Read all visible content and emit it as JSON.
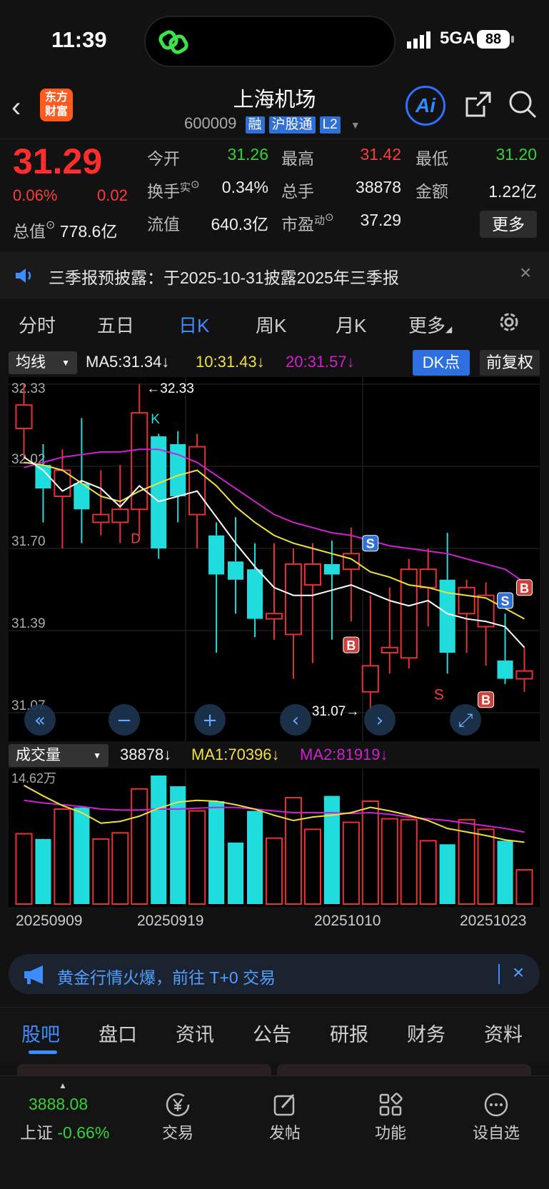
{
  "status": {
    "time": "11:39",
    "network": "5GA",
    "battery": "88"
  },
  "header": {
    "logo": [
      "东方",
      "财富"
    ],
    "title": "上海机场",
    "code": "600009",
    "tags": [
      "融",
      "沪股通",
      "L2"
    ],
    "ai_label": "Ai"
  },
  "quote": {
    "price": "31.29",
    "pct": "0.06%",
    "change": "0.02",
    "mktcap_label": "总值",
    "mktcap": "778.6亿",
    "open_label": "今开",
    "open": "31.26",
    "high_label": "最高",
    "high": "31.42",
    "low_label": "最低",
    "low": "31.20",
    "turnover_label": "换手",
    "turnover_sup": "实",
    "turnover": "0.34%",
    "volume_label": "总手",
    "volume": "38878",
    "amount_label": "金额",
    "amount": "1.22亿",
    "float_label": "流值",
    "float": "640.3亿",
    "pe_label": "市盈",
    "pe_sup": "动",
    "pe": "37.29",
    "more": "更多"
  },
  "notice": {
    "text": "三季报预披露：于2025-10-31披露2025年三季报",
    "close": "×"
  },
  "tabs": [
    {
      "label": "分时"
    },
    {
      "label": "五日"
    },
    {
      "label": "日K"
    },
    {
      "label": "周K"
    },
    {
      "label": "月K"
    },
    {
      "label": "更多"
    }
  ],
  "indicators": {
    "main_dropdown": "均线",
    "ma5": "MA5:31.34↓",
    "ma10": "10:31.43↓",
    "ma20": "20:31.57↓",
    "dk": "DK点",
    "fq": "前复权",
    "vol_dropdown": "成交量",
    "vol": "38878↓",
    "vma1": "MA1:70396↓",
    "vma2": "MA2:81919↓"
  },
  "chart_data": [
    {
      "type": "candlestick",
      "title": "",
      "yticks": [
        "32.33",
        "32.02",
        "31.70",
        "31.39",
        "31.07"
      ],
      "ylim": [
        31.07,
        32.33
      ],
      "annotations": {
        "high": "←32.33",
        "low": "31.07→",
        "k": "K",
        "d": "D",
        "s_text": "S"
      },
      "signals": [
        {
          "label": "S",
          "index": 18
        },
        {
          "label": "B",
          "index": 17
        },
        {
          "label": "S",
          "index": 25
        },
        {
          "label": "B",
          "index": 24
        },
        {
          "label": "B",
          "index": 26
        }
      ],
      "candles": [
        {
          "o": 32.16,
          "c": 32.25,
          "h": 32.33,
          "l": 32.05
        },
        {
          "o": 32.02,
          "c": 31.93,
          "h": 32.1,
          "l": 31.8
        },
        {
          "o": 31.9,
          "c": 32.0,
          "h": 32.08,
          "l": 31.7
        },
        {
          "o": 31.95,
          "c": 31.85,
          "h": 32.2,
          "l": 31.72
        },
        {
          "o": 31.8,
          "c": 31.83,
          "h": 32.0,
          "l": 31.75
        },
        {
          "o": 31.8,
          "c": 31.85,
          "h": 32.02,
          "l": 31.72
        },
        {
          "o": 31.85,
          "c": 32.22,
          "h": 32.33,
          "l": 31.75
        },
        {
          "o": 32.13,
          "c": 31.7,
          "h": 32.14,
          "l": 31.66
        },
        {
          "o": 32.1,
          "c": 31.9,
          "h": 32.15,
          "l": 31.8
        },
        {
          "o": 31.83,
          "c": 32.09,
          "h": 32.14,
          "l": 31.7
        },
        {
          "o": 31.75,
          "c": 31.6,
          "h": 31.8,
          "l": 31.3
        },
        {
          "o": 31.65,
          "c": 31.58,
          "h": 31.82,
          "l": 31.45
        },
        {
          "o": 31.62,
          "c": 31.43,
          "h": 31.72,
          "l": 31.36
        },
        {
          "o": 31.43,
          "c": 31.45,
          "h": 31.72,
          "l": 31.35
        },
        {
          "o": 31.37,
          "c": 31.64,
          "h": 31.7,
          "l": 31.2
        },
        {
          "o": 31.56,
          "c": 31.64,
          "h": 31.72,
          "l": 31.26
        },
        {
          "o": 31.64,
          "c": 31.6,
          "h": 31.73,
          "l": 31.35
        },
        {
          "o": 31.62,
          "c": 31.68,
          "h": 31.78,
          "l": 31.42
        },
        {
          "o": 31.15,
          "c": 31.25,
          "h": 31.52,
          "l": 31.07
        },
        {
          "o": 31.3,
          "c": 31.32,
          "h": 31.55,
          "l": 31.22
        },
        {
          "o": 31.28,
          "c": 31.62,
          "h": 31.66,
          "l": 31.24
        },
        {
          "o": 31.55,
          "c": 31.62,
          "h": 31.7,
          "l": 31.4
        },
        {
          "o": 31.58,
          "c": 31.3,
          "h": 31.76,
          "l": 31.22
        },
        {
          "o": 31.45,
          "c": 31.55,
          "h": 31.58,
          "l": 31.3
        },
        {
          "o": 31.4,
          "c": 31.52,
          "h": 31.57,
          "l": 31.25
        },
        {
          "o": 31.27,
          "c": 31.2,
          "h": 31.45,
          "l": 31.18
        },
        {
          "o": 31.2,
          "c": 31.23,
          "h": 31.32,
          "l": 31.15
        }
      ],
      "ma5": [
        32.05,
        32.0,
        31.92,
        31.96,
        31.93,
        31.86,
        31.94,
        31.88,
        31.9,
        31.92,
        31.82,
        31.72,
        31.63,
        31.55,
        31.52,
        31.52,
        31.54,
        31.56,
        31.53,
        31.5,
        31.48,
        31.5,
        31.45,
        31.43,
        31.42,
        31.4,
        31.32
      ],
      "ma10": [
        32.03,
        32.02,
        32.0,
        31.95,
        31.9,
        31.88,
        31.92,
        31.95,
        31.98,
        32.0,
        31.94,
        31.86,
        31.8,
        31.75,
        31.72,
        31.7,
        31.68,
        31.66,
        31.61,
        31.59,
        31.56,
        31.55,
        31.53,
        31.52,
        31.51,
        31.47,
        31.43
      ],
      "ma20": [
        32.01,
        32.03,
        32.05,
        32.06,
        32.07,
        32.07,
        32.08,
        32.08,
        32.06,
        32.03,
        31.98,
        31.93,
        31.88,
        31.83,
        31.8,
        31.78,
        31.76,
        31.75,
        31.73,
        31.71,
        31.7,
        31.69,
        31.68,
        31.66,
        31.64,
        31.62,
        31.57
      ]
    },
    {
      "type": "bar",
      "title": "",
      "ymax_label": "14.62万",
      "ylim": [
        0,
        146200
      ],
      "volumes": [
        80000,
        74000,
        108000,
        110000,
        74000,
        81000,
        131000,
        146200,
        134000,
        106000,
        117000,
        70000,
        106000,
        75000,
        121000,
        85000,
        123000,
        93000,
        117000,
        97000,
        96000,
        72000,
        68000,
        96000,
        85000,
        72000,
        38878
      ],
      "vma1": [
        135000,
        123000,
        112000,
        104000,
        92000,
        94000,
        100000,
        109000,
        116000,
        118000,
        117000,
        113000,
        108000,
        101000,
        95000,
        99000,
        101000,
        104000,
        110000,
        106000,
        101000,
        95000,
        86000,
        82000,
        78000,
        73000,
        70396
      ],
      "vma2": [
        118000,
        115000,
        113000,
        111000,
        108000,
        107000,
        107000,
        108000,
        108000,
        109000,
        110000,
        110000,
        108000,
        106000,
        104000,
        104000,
        104000,
        103000,
        104000,
        102000,
        99000,
        97000,
        95000,
        92000,
        89000,
        86000,
        81919
      ],
      "dates": [
        "20250909",
        "20250919",
        "20251010",
        "20251023"
      ]
    }
  ],
  "promo": {
    "text": "黄金行情火爆，前往 T+0 交易",
    "close": "×"
  },
  "bottom_tabs": [
    {
      "label": "股吧"
    },
    {
      "label": "盘口"
    },
    {
      "label": "资讯"
    },
    {
      "label": "公告"
    },
    {
      "label": "研报"
    },
    {
      "label": "财务"
    },
    {
      "label": "资料"
    }
  ],
  "dock": {
    "index_value": "3888.08",
    "index_name": "上证",
    "index_pct": "-0.66%",
    "items": [
      {
        "label": "交易"
      },
      {
        "label": "发帖"
      },
      {
        "label": "功能"
      },
      {
        "label": "设自选"
      }
    ]
  },
  "colors": {
    "up": "#e63232",
    "down": "#20dcdc",
    "ma5": "#ffffff",
    "ma10": "#f0e040",
    "ma20": "#d020d0",
    "accent": "#3f8cff"
  }
}
